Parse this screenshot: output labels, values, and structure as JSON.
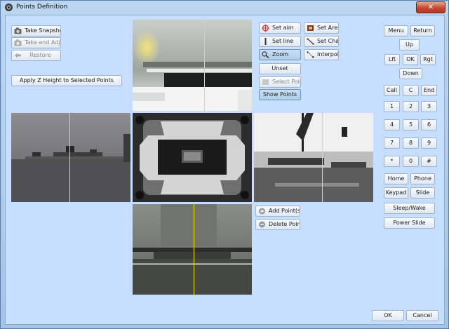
{
  "window": {
    "title": "Points Definition",
    "close_glyph": "✕"
  },
  "left_buttons": {
    "take_snapshots": "Take Snapshots",
    "take_and_adjust": "Take and Adjust",
    "restore": "Restore",
    "apply_z": "Apply Z Height to Selected Points"
  },
  "center_buttons": {
    "set_aim": "Set aim",
    "set_area": "Set Area",
    "set_line": "Set line",
    "set_chain": "Set Chain",
    "zoom": "Zoom",
    "interpolate": "Interpolate",
    "unset": "Unset",
    "select_points": "Select Points",
    "show_points": "Show Points",
    "add_points": "Add Point(s)",
    "delete_points": "Delete Point(s)"
  },
  "keypad": {
    "menu": "Menu",
    "return": "Return",
    "up": "Up",
    "left": "Lft",
    "ok": "OK",
    "right": "Rgt",
    "down": "Down",
    "call": "Call",
    "c": "C",
    "end": "End",
    "digits": [
      "1",
      "2",
      "3",
      "4",
      "5",
      "6",
      "7",
      "8",
      "9",
      "*",
      "0",
      "#"
    ],
    "home": "Home",
    "phone": "Phone",
    "keypad": "Keypad",
    "slide": "Slide",
    "sleep_wake": "Sleep/Wake",
    "power_slide": "Power Slide"
  },
  "dialog": {
    "ok": "OK",
    "cancel": "Cancel"
  },
  "icons": {
    "title": "camera-icon",
    "snapshot": "camera-icon",
    "adjust": "camera-icon",
    "restore": "back-arrow-icon",
    "aim": "target-icon",
    "area": "area-icon",
    "line": "line-icon",
    "chain": "chain-icon",
    "zoom": "magnifier-icon",
    "interpolate": "interpolate-icon",
    "add": "plus-circle-icon",
    "delete": "minus-circle-icon"
  },
  "colors": {
    "cursor_line": "#f2e600",
    "window_bg": "#c6deff",
    "close": "#c64a32"
  }
}
